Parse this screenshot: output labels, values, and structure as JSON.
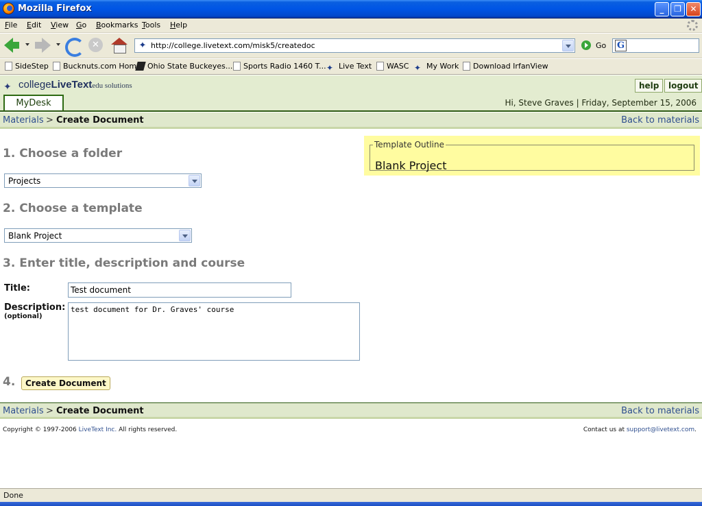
{
  "window": {
    "title": "Mozilla Firefox"
  },
  "menu": [
    "File",
    "Edit",
    "View",
    "Go",
    "Bookmarks",
    "Tools",
    "Help"
  ],
  "navbar": {
    "url": "http://college.livetext.com/misk5/createdoc",
    "go_label": "Go"
  },
  "bookmarks": [
    "SideStep",
    "Bucknuts.com Home",
    "Ohio State Buckeyes...",
    "Sports Radio 1460 T...",
    "Live Text",
    "WASC",
    "My Work",
    "Download IrfanView"
  ],
  "header": {
    "brand_part1": "college",
    "brand_part2": "LiveText",
    "brand_part3": "edu solutions",
    "help_label": "help",
    "logout_label": "logout",
    "tab_label": "MyDesk",
    "greeting": "Hi, Steve Graves  |   Friday, September 15, 2006"
  },
  "breadcrumb": {
    "parent": "Materials",
    "separator": ">",
    "current": "Create Document",
    "back_link": "Back to materials"
  },
  "form": {
    "step1_heading": "1. Choose a folder",
    "folder_value": "Projects",
    "step2_heading": "2. Choose a template",
    "template_value": "Blank Project",
    "step3_heading": "3. Enter title, description and course",
    "title_label": "Title:",
    "title_value": "Test document",
    "description_label": "Description:",
    "description_sub": "(optional)",
    "description_value": "test document for Dr. Graves' course",
    "step4_label": "4.",
    "create_button": "Create Document"
  },
  "outline": {
    "legend": "Template Outline",
    "value": "Blank Project"
  },
  "footer": {
    "copyright_pre": "Copyright © 1997-2006 ",
    "copyright_link": "LiveText Inc.",
    "copyright_post": " All rights reserved.",
    "contact_pre": "Contact us at ",
    "contact_link": "support@livetext.com",
    "contact_post": "."
  },
  "status": "Done"
}
